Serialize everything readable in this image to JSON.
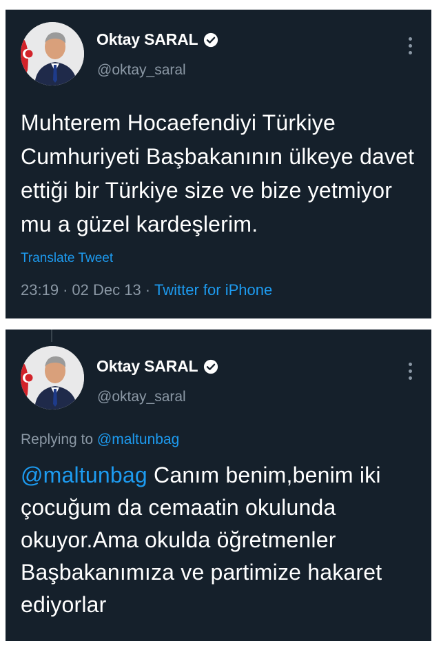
{
  "tweets": [
    {
      "author_name": "Oktay SARAL",
      "handle": "@oktay_saral",
      "text": "Muhterem Hocaefendiyi Türkiye Cumhuriyeti Başbakanının ülkeye davet ettiği bir Türkiye size ve bize yetmiyor mu a güzel kardeşlerim.",
      "translate_label": "Translate Tweet",
      "time": "23:19",
      "date": "02 Dec 13",
      "separator": "·",
      "source": "Twitter for iPhone"
    },
    {
      "author_name": "Oktay SARAL",
      "handle": "@oktay_saral",
      "replying_prefix": "Replying to",
      "replying_to": "@maltunbag",
      "mention": "@maltunbag",
      "text": "Canım benim,benim iki çocuğum da cemaatin okulunda okuyor.Ama okulda öğretmenler Başbakanımıza ve partimize hakaret ediyorlar"
    }
  ],
  "colors": {
    "background": "#15202b",
    "text": "#ffffff",
    "muted": "#8b98a5",
    "accent": "#1d9bf0"
  },
  "icons": {
    "verified": "verified-badge-icon",
    "more": "more-options-icon"
  }
}
